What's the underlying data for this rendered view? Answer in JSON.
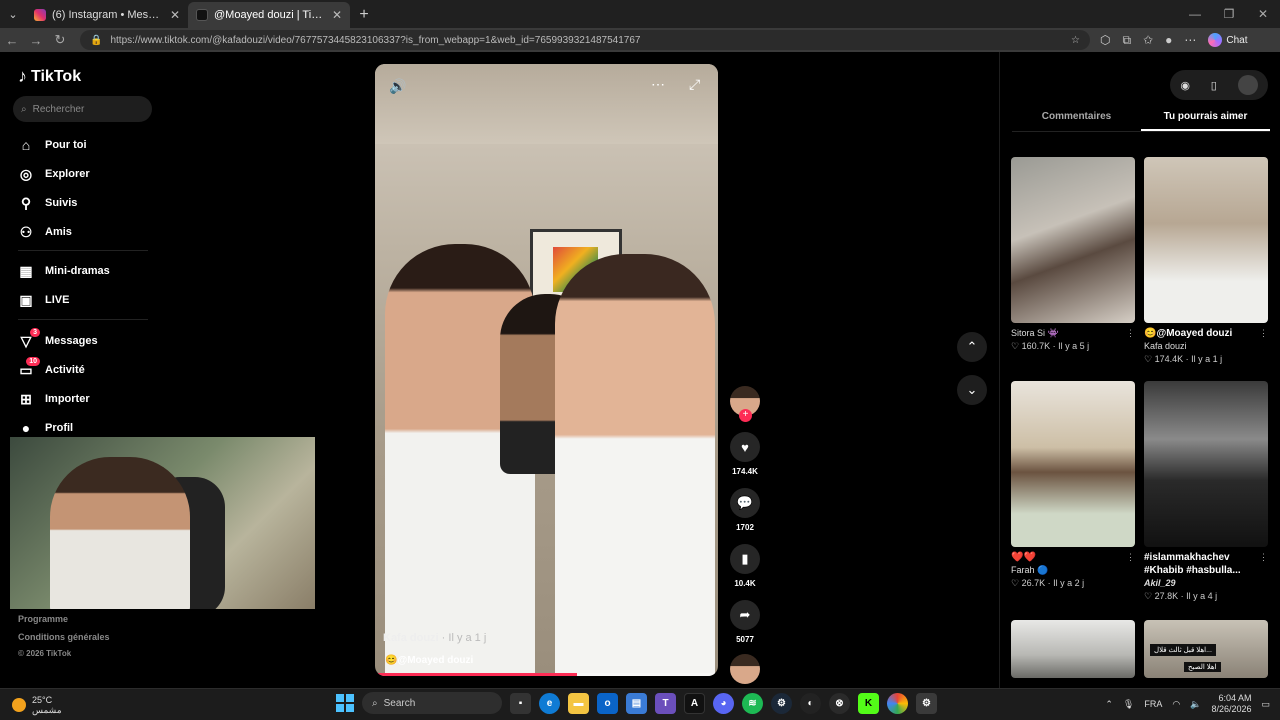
{
  "browser": {
    "tabs": [
      {
        "title": "(6) Instagram • Messages",
        "active": false
      },
      {
        "title": "@Moayed douzi | TikTok",
        "active": true
      }
    ],
    "url": "https://www.tiktok.com/@kafadouzi/video/7677573445823106337?is_from_webapp=1&web_id=7659939321487541767",
    "chat_label": "Chat"
  },
  "sidebar": {
    "logo": "TikTok",
    "search_placeholder": "Rechercher",
    "items": [
      {
        "label": "Pour toi",
        "icon": "home-icon"
      },
      {
        "label": "Explorer",
        "icon": "compass-icon"
      },
      {
        "label": "Suivis",
        "icon": "following-icon"
      },
      {
        "label": "Amis",
        "icon": "friends-icon"
      },
      {
        "label": "Mini-dramas",
        "icon": "film-icon"
      },
      {
        "label": "LIVE",
        "icon": "live-icon"
      },
      {
        "label": "Messages",
        "icon": "messages-icon",
        "badge": "3"
      },
      {
        "label": "Activité",
        "icon": "activity-icon",
        "badge": "10"
      },
      {
        "label": "Importer",
        "icon": "upload-icon"
      },
      {
        "label": "Profil",
        "icon": "profile-icon"
      }
    ],
    "footer": {
      "programme": "Programme",
      "conditions": "Conditions générales",
      "copyright": "© 2026 TikTok"
    }
  },
  "video": {
    "author": "Kafa douzi",
    "time": " · Il y a 1 j",
    "sound": "😊@Moayed douzi",
    "progress": 0.59
  },
  "actions": {
    "likes": "174.4K",
    "comments": "1702",
    "saves": "10.4K",
    "shares": "5077"
  },
  "rpanel": {
    "tab_comments": "Commentaires",
    "tab_suggest": "Tu pourrais aimer",
    "cards": [
      {
        "title": "",
        "author": "Sitora Si 👾",
        "likes": "♡ 160.7K",
        "time": "Il y a 5 j",
        "bg": "linear-gradient(160deg,#9a9a94 0%,#c7c1b8 40%,#5a4a40 60%,#d6cfc6 100%)"
      },
      {
        "title": "😊@Moayed douzi",
        "author": "Kafa douzi",
        "likes": "♡ 174.4K",
        "time": "Il y a 1 j",
        "bg": "linear-gradient(180deg,#cfc6b8 0%,#b7a793 40%,#efefec 75%)"
      },
      {
        "title": "❤️❤️",
        "author": "Farah 🔵",
        "likes": "♡ 26.7K",
        "time": "Il y a 2 j",
        "bg": "linear-gradient(180deg,#e9e4dc 0%,#cdbfa6 40%,#6b5340 55%,#cfd8c6 80%)"
      },
      {
        "title": "#islammakhachev #Khabib #hasbulla...",
        "author": "Akil_29",
        "likes": "♡ 27.8K",
        "time": "Il y a 4 j",
        "bg": "linear-gradient(180deg,#3a3a3a 0%,#8a8a8a 35%,#2a2a2a 60%,#111 100%)"
      },
      {
        "title": "",
        "author": "",
        "likes": "",
        "time": "",
        "bg": "linear-gradient(180deg,#e8e8e6 0%,#b8b8b4 60%,#6a6a66 100%)"
      },
      {
        "title": "",
        "author": "",
        "likes": "",
        "time": "",
        "bg": "linear-gradient(180deg,#c8c2b6 0%,#8a8276 100%)"
      }
    ],
    "card6_caption": "اهلا قبل ثالث قلال...",
    "card6_caption2": "اهلا الصبح"
  },
  "taskbar": {
    "temp": "25°C",
    "weather_text": "مشمس",
    "search": "Search",
    "lang": "FRA",
    "time": "6:04 AM",
    "date": "8/26/2026"
  },
  "colors": {
    "accent": "#fe2c55",
    "badge": "#fe2c55"
  }
}
